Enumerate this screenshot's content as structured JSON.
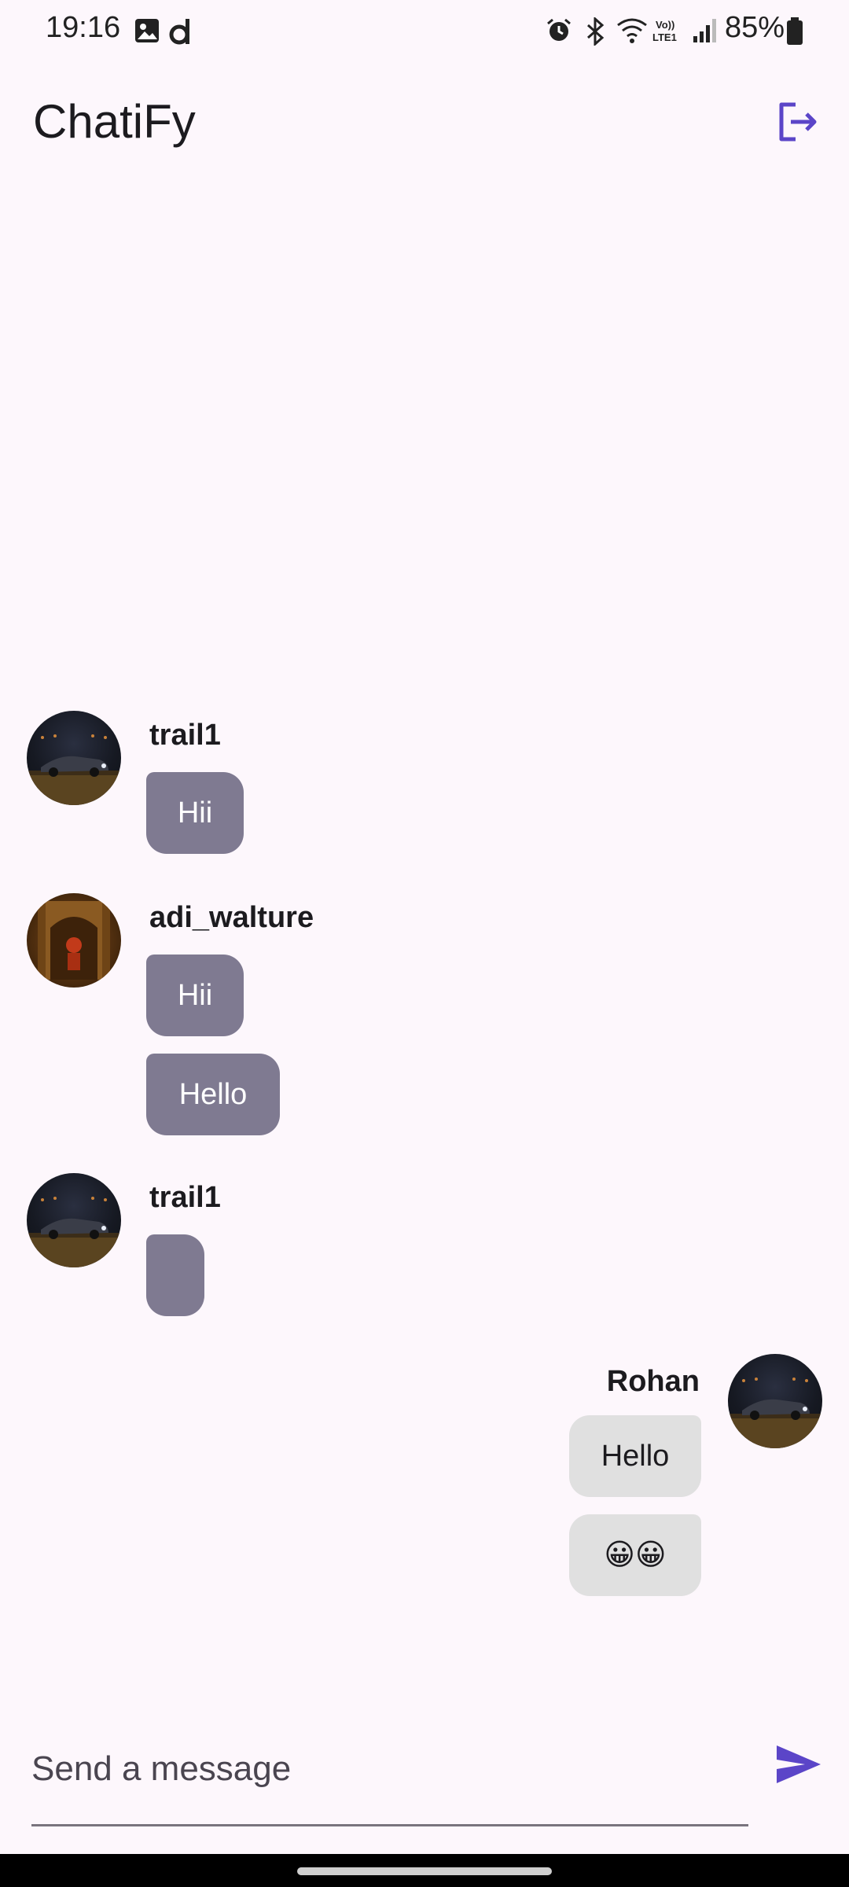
{
  "status_bar": {
    "time": "19:16",
    "battery": "85%",
    "icons": [
      "gallery-icon",
      "d-app-icon",
      "alarm-icon",
      "bluetooth-icon",
      "wifi-icon",
      "volte-icon",
      "signal-icon",
      "battery-icon"
    ]
  },
  "app_bar": {
    "title": "ChatiFy",
    "logout_icon": "logout-icon"
  },
  "messages": [
    {
      "username": "trail1",
      "avatar": "car-avatar",
      "bubbles": [
        "Hii"
      ],
      "side": "other"
    },
    {
      "username": "adi_walture",
      "avatar": "temple-avatar",
      "bubbles": [
        "Hii",
        "Hello"
      ],
      "side": "other"
    },
    {
      "username": "trail1",
      "avatar": "car-avatar",
      "bubbles": [
        ""
      ],
      "side": "other"
    },
    {
      "username": "Rohan",
      "avatar": "car-avatar",
      "bubbles": [
        "Hello",
        "😀😀"
      ],
      "side": "self"
    }
  ],
  "composer": {
    "placeholder": "Send a message",
    "value": "",
    "send_icon": "send-icon"
  },
  "colors": {
    "accent": "#5b45c8",
    "bubble_other": "#7f7a91",
    "bubble_self": "#e0e0e0",
    "background": "#fdf7fc"
  }
}
